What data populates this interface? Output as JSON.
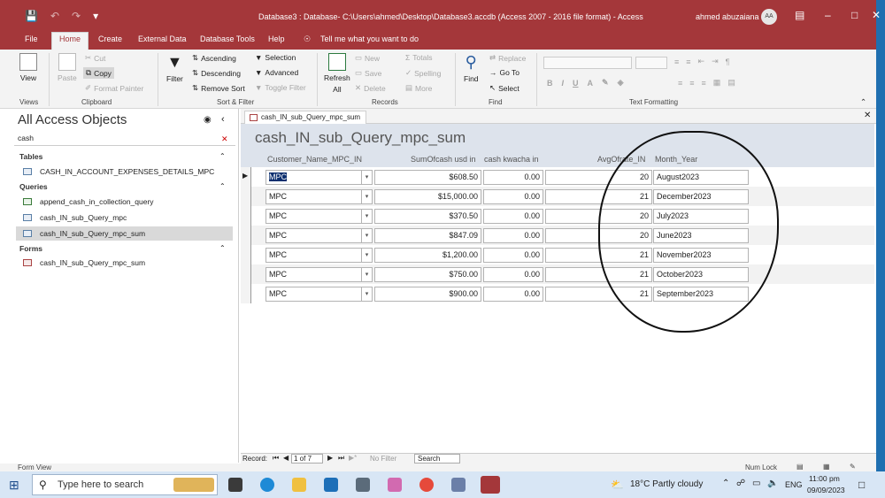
{
  "window": {
    "title": "Database3 : Database- C:\\Users\\ahmed\\Desktop\\Database3.accdb (Access 2007 - 2016 file format)  -  Access",
    "user": "ahmed abuzaiana",
    "user_initials": "AA"
  },
  "tabs": [
    "File",
    "Home",
    "Create",
    "External Data",
    "Database Tools",
    "Help"
  ],
  "tell_me": "Tell me what you want to do",
  "ribbon": {
    "views": {
      "view": "View",
      "label": "Views"
    },
    "clipboard": {
      "paste": "Paste",
      "cut": "Cut",
      "copy": "Copy",
      "format_painter": "Format Painter",
      "label": "Clipboard"
    },
    "sort_filter": {
      "filter": "Filter",
      "ascending": "Ascending",
      "descending": "Descending",
      "remove_sort": "Remove Sort",
      "selection": "Selection",
      "advanced": "Advanced",
      "toggle_filter": "Toggle Filter",
      "label": "Sort & Filter"
    },
    "records": {
      "refresh": "Refresh",
      "refresh_all": "All",
      "new": "New",
      "save": "Save",
      "delete": "Delete",
      "totals": "Totals",
      "spelling": "Spelling",
      "more": "More",
      "label": "Records"
    },
    "find": {
      "find": "Find",
      "replace": "Replace",
      "goto": "Go To",
      "select": "Select",
      "label": "Find"
    },
    "text_formatting": {
      "bold": "B",
      "italic": "I",
      "underline": "U",
      "label": "Text Formatting"
    }
  },
  "navpane": {
    "header": "All Access Objects",
    "search": "cash",
    "sections": [
      {
        "name": "Tables",
        "items": [
          "CASH_IN_ACCOUNT_EXPENSES_DETAILS_MPC"
        ]
      },
      {
        "name": "Queries",
        "items": [
          "append_cash_in_collection_query",
          "cash_IN_sub_Query_mpc",
          "cash_IN_sub_Query_mpc_sum"
        ]
      },
      {
        "name": "Forms",
        "items": [
          "cash_IN_sub_Query_mpc_sum"
        ]
      }
    ]
  },
  "document": {
    "tab": "cash_IN_sub_Query_mpc_sum",
    "title": "cash_IN_sub_Query_mpc_sum",
    "columns": [
      "Customer_Name_MPC_IN",
      "SumOfcash usd in",
      "cash kwacha in",
      "AvgOfrate_IN",
      "Month_Year"
    ],
    "rows": [
      [
        "MPC",
        "$608.50",
        "0.00",
        "20",
        "August2023"
      ],
      [
        "MPC",
        "$15,000.00",
        "0.00",
        "21",
        "December2023"
      ],
      [
        "MPC",
        "$370.50",
        "0.00",
        "20",
        "July2023"
      ],
      [
        "MPC",
        "$847.09",
        "0.00",
        "20",
        "June2023"
      ],
      [
        "MPC",
        "$1,200.00",
        "0.00",
        "21",
        "November2023"
      ],
      [
        "MPC",
        "$750.00",
        "0.00",
        "21",
        "October2023"
      ],
      [
        "MPC",
        "$900.00",
        "0.00",
        "21",
        "September2023"
      ]
    ]
  },
  "record_nav": {
    "label": "Record:",
    "position": "1 of 7",
    "no_filter": "No Filter",
    "search": "Search"
  },
  "status": {
    "left": "Form View",
    "right": "Num Lock"
  },
  "taskbar": {
    "search_placeholder": "Type here to search",
    "weather": "18°C  Partly cloudy",
    "lang": "ENG",
    "time": "11:00 pm",
    "date": "09/09/2023"
  }
}
